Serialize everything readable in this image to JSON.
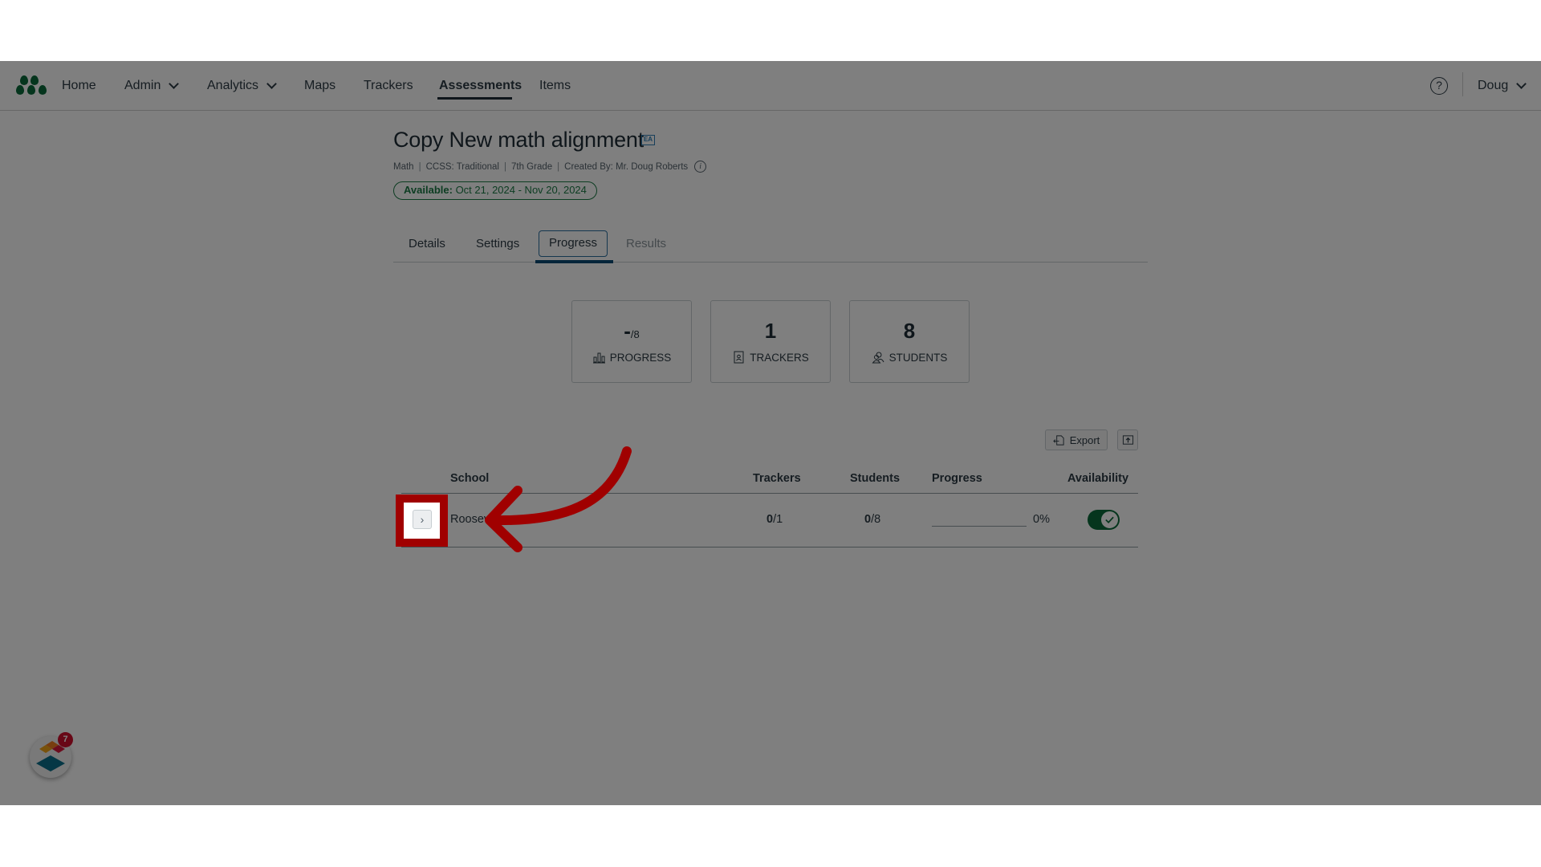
{
  "nav": {
    "items": [
      {
        "label": "Home"
      },
      {
        "label": "Admin",
        "has_dropdown": true
      },
      {
        "label": "Analytics",
        "has_dropdown": true
      },
      {
        "label": "Maps"
      },
      {
        "label": "Trackers"
      },
      {
        "label": "Assessments",
        "active": true
      },
      {
        "label": "Items"
      }
    ],
    "help_icon": "question-circle-icon",
    "user": "Doug"
  },
  "assessment": {
    "title": "Copy New math alignment",
    "badge": "EA",
    "meta": {
      "subject": "Math",
      "standard": "CCSS: Traditional",
      "grade": "7th Grade",
      "created_by": "Created By: Mr. Doug Roberts"
    },
    "availability": {
      "label": "Available:",
      "range": "Oct 21, 2024 - Nov 20, 2024"
    }
  },
  "tabs": [
    {
      "label": "Details"
    },
    {
      "label": "Settings"
    },
    {
      "label": "Progress",
      "active": true
    },
    {
      "label": "Results",
      "disabled": true
    }
  ],
  "stats": {
    "progress": {
      "value": "-",
      "denominator": "/8",
      "label": "PROGRESS",
      "icon": "bar-chart-icon"
    },
    "trackers": {
      "value": "1",
      "label": "TRACKERS",
      "icon": "tracker-notebook-icon"
    },
    "students": {
      "value": "8",
      "label": "STUDENTS",
      "icon": "students-icon"
    }
  },
  "toolbar": {
    "export_label": "Export",
    "upload_icon": "upload-icon"
  },
  "table": {
    "columns": [
      "School",
      "Trackers",
      "Students",
      "Progress",
      "Availability"
    ],
    "rows": [
      {
        "school": "Roosev",
        "trackers_done": "0",
        "trackers_total": "/1",
        "students_done": "0",
        "students_total": "/8",
        "progress_percent": 0,
        "progress_label": "0%",
        "available": true
      }
    ]
  },
  "chat_widget": {
    "badge_count": "7"
  },
  "annotation": {
    "color": "#a00000",
    "target": "expand-row-button"
  }
}
